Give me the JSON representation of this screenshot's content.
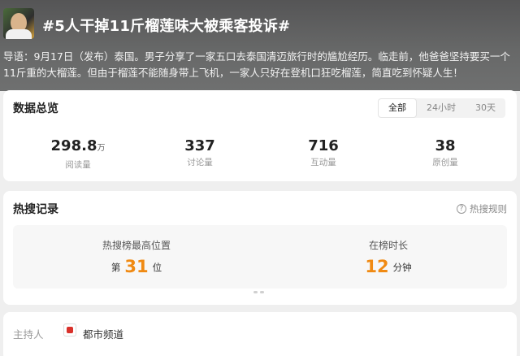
{
  "topic": {
    "title": "#5人干掉11斤榴莲味大被乘客投诉#",
    "intro": "导语：9月17日（发布）泰国。男子分享了一家五口去泰国清迈旅行时的尴尬经历。临走前，他爸爸坚持要买一个11斤重的大榴莲。但由于榴莲不能随身带上飞机，一家人只好在登机口狂吃榴莲，简直吃到怀疑人生！"
  },
  "overview": {
    "title": "数据总览",
    "tabs": [
      {
        "label": "全部",
        "active": true
      },
      {
        "label": "24小时",
        "active": false
      },
      {
        "label": "30天",
        "active": false
      }
    ],
    "stats": [
      {
        "value": "298.8",
        "unit": "万",
        "label": "阅读量"
      },
      {
        "value": "337",
        "unit": "",
        "label": "讨论量"
      },
      {
        "value": "716",
        "unit": "",
        "label": "互动量"
      },
      {
        "value": "38",
        "unit": "",
        "label": "原创量"
      }
    ]
  },
  "hot": {
    "title": "热搜记录",
    "rules_label": "热搜规则",
    "rules_icon": "question-circle-icon",
    "peak": {
      "label": "热搜榜最高位置",
      "prefix": "第",
      "value": "31",
      "suffix": "位"
    },
    "duration": {
      "label": "在榜时长",
      "value": "12",
      "suffix": "分钟"
    },
    "accent_color": "#f08a13"
  },
  "host": {
    "label": "主持人",
    "name": "都市频道",
    "icon": "channel-logo-icon"
  }
}
